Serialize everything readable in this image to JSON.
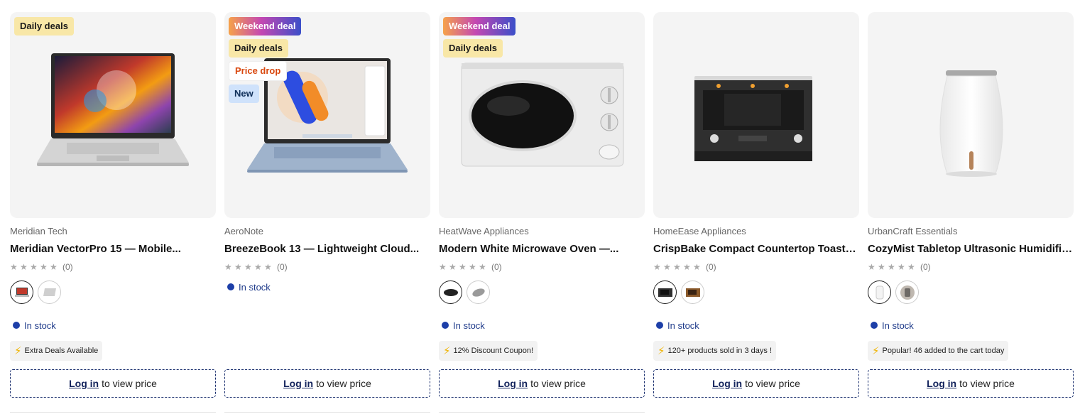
{
  "products": [
    {
      "badges": [
        {
          "type": "daily",
          "label": "Daily deals"
        }
      ],
      "brand": "Meridian Tech",
      "title": "Meridian VectorPro 15 — Mobile...",
      "rating_count": "(0)",
      "swatches": 2,
      "stock": "In stock",
      "promo": "Extra Deals Available",
      "login_label": "Log in",
      "login_suffix": "to view price"
    },
    {
      "badges": [
        {
          "type": "weekend",
          "label": "Weekend deal"
        },
        {
          "type": "daily",
          "label": "Daily deals"
        },
        {
          "type": "pricedrop",
          "label": "Price drop"
        },
        {
          "type": "new",
          "label": "New"
        }
      ],
      "brand": "AeroNote",
      "title": "BreezeBook 13 — Lightweight Cloud...",
      "rating_count": "(0)",
      "swatches": 0,
      "stock": "In stock",
      "promo": "",
      "login_label": "Log in",
      "login_suffix": "to view price"
    },
    {
      "badges": [
        {
          "type": "weekend",
          "label": "Weekend deal"
        },
        {
          "type": "daily",
          "label": "Daily deals"
        }
      ],
      "brand": "HeatWave Appliances",
      "title": "Modern White Microwave Oven —...",
      "rating_count": "(0)",
      "swatches": 2,
      "stock": "In stock",
      "promo": "12% Discount Coupon!",
      "login_label": "Log in",
      "login_suffix": "to view price"
    },
    {
      "badges": [],
      "brand": "HomeEase Appliances",
      "title": "CrispBake Compact Countertop Toaste...",
      "rating_count": "(0)",
      "swatches": 2,
      "stock": "In stock",
      "promo": "120+ products sold in 3 days !",
      "login_label": "Log in",
      "login_suffix": "to view price"
    },
    {
      "badges": [],
      "brand": "UrbanCraft Essentials",
      "title": "CozyMist Tabletop Ultrasonic Humidifie...",
      "rating_count": "(0)",
      "swatches": 2,
      "stock": "In stock",
      "promo": "Popular! 46 added to the cart today",
      "login_label": "Log in",
      "login_suffix": "to view price"
    }
  ],
  "colors": {
    "stock_dot": "#1d3fa8",
    "login_border": "#1a2f6e",
    "card_bg": "#f4f4f4"
  },
  "icons": {
    "star": "star-icon",
    "bolt": "lightning-icon",
    "dot": "status-dot-icon"
  }
}
